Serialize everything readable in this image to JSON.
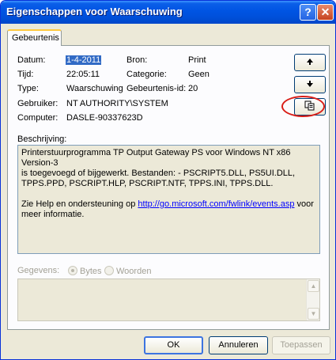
{
  "window": {
    "title": "Eigenschappen voor Waarschuwing",
    "help_label": "?",
    "close_label": "✕"
  },
  "tab": {
    "label": "Gebeurtenis"
  },
  "fields": {
    "datum_label": "Datum:",
    "datum_value": "1-4-2011",
    "bron_label": "Bron:",
    "bron_value": "Print",
    "tijd_label": "Tijd:",
    "tijd_value": "22:05:11",
    "categorie_label": "Categorie:",
    "categorie_value": "Geen",
    "type_label": "Type:",
    "type_value": "Waarschuwing",
    "id_label": "Gebeurtenis-id:",
    "id_value": "20",
    "gebruiker_label": "Gebruiker:",
    "gebruiker_value": "NT AUTHORITY\\SYSTEM",
    "computer_label": "Computer:",
    "computer_value": "DASLE-90337623D"
  },
  "nav": {
    "up_icon": "arrow-up-icon",
    "down_icon": "arrow-down-icon",
    "copy_icon": "copy-icon"
  },
  "description": {
    "label": "Beschrijving:",
    "line1": "Printerstuurprogramma TP Output Gateway PS voor Windows NT x86 Version-3",
    "line2": "is toegevoegd of bijgewerkt. Bestanden: - PSCRIPT5.DLL, PS5UI.DLL,",
    "line3": "TPPS.PPD, PSCRIPT.HLP, PSCRIPT.NTF, TPPS.INI, TPPS.DLL.",
    "help_prefix": "Zie Help en ondersteuning op ",
    "help_link": "http://go.microsoft.com/fwlink/events.asp",
    "help_suffix": " voor",
    "help_line2": "meer informatie."
  },
  "data_section": {
    "label": "Gegevens:",
    "bytes_label": "Bytes",
    "words_label": "Woorden",
    "selected": "Bytes"
  },
  "buttons": {
    "ok": "OK",
    "cancel": "Annuleren",
    "apply": "Toepassen"
  },
  "colors": {
    "title_bar": "#0054e3",
    "selection": "#316ac5",
    "highlight_ring": "#d91e18"
  }
}
